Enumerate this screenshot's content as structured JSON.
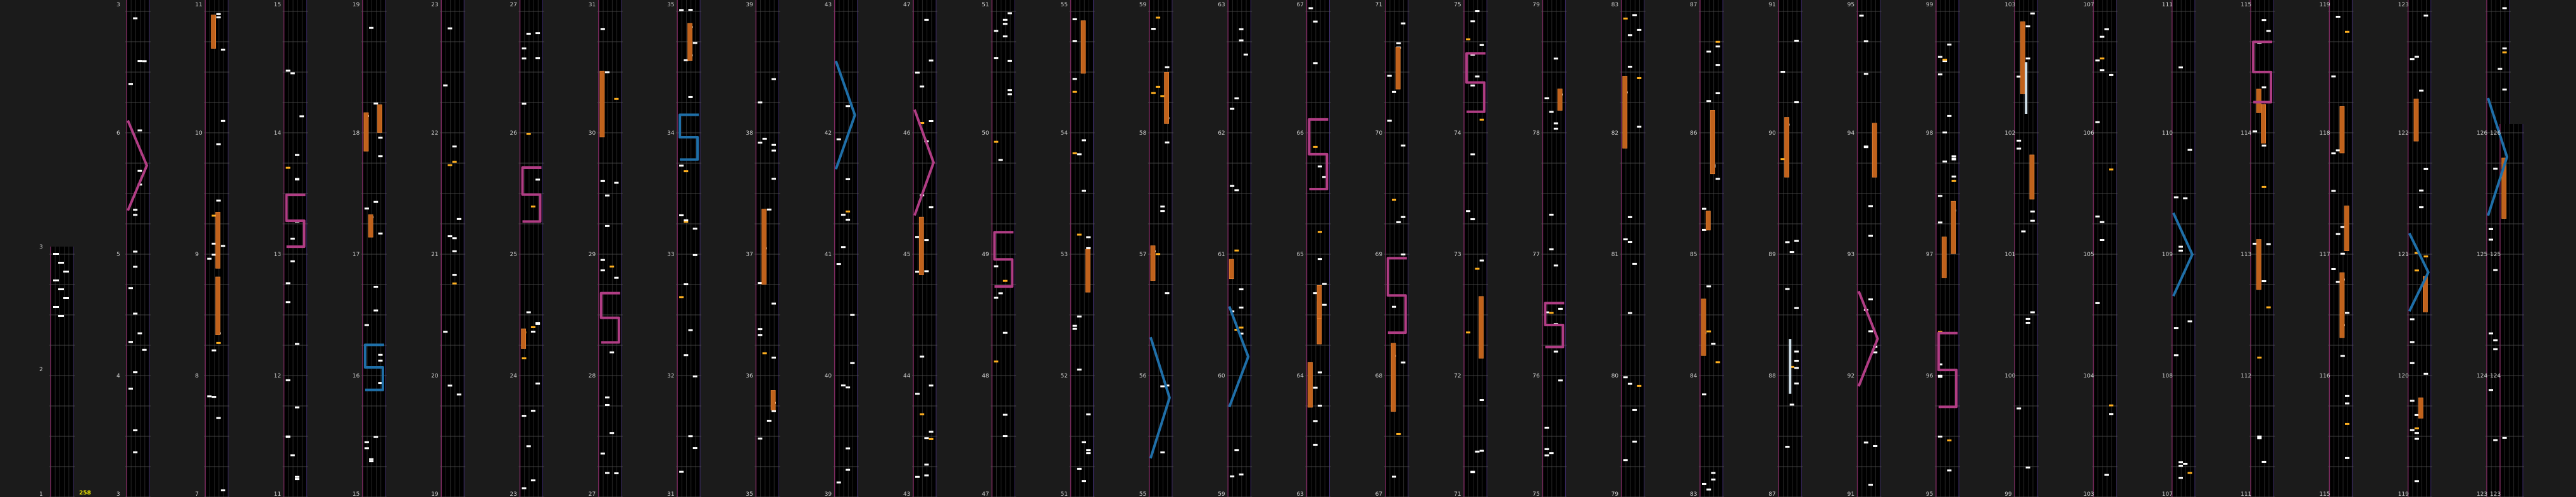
{
  "chart_view": {
    "left_column": {
      "measures": [
        "1",
        "2",
        "3"
      ],
      "combo": "258"
    },
    "measure_labels_first": [
      "3",
      "11",
      "15",
      "19",
      "23",
      "27",
      "31",
      "35",
      "39",
      "43",
      "47",
      "51",
      "55",
      "59",
      "63",
      "67",
      "71",
      "75",
      "79",
      "83",
      "87",
      "91",
      "95",
      "99",
      "103",
      "107",
      "111",
      "115",
      "119",
      "123"
    ],
    "measure_labels_last": [
      "3",
      "7",
      "11",
      "15",
      "19",
      "23",
      "27",
      "31",
      "35",
      "39",
      "43",
      "47",
      "51",
      "55",
      "59",
      "63",
      "67",
      "71",
      "75",
      "79",
      "83",
      "87",
      "91",
      "95",
      "99",
      "103",
      "107",
      "111",
      "115",
      "119",
      "123"
    ],
    "last_column": {
      "measures": [
        "123",
        "124",
        "125",
        "126"
      ]
    },
    "colors": {
      "background": "#1b1b1b",
      "lane": "#000000",
      "beat_line": "#555555",
      "subdivision_line": "#262626",
      "left_border": "#7a2a5e",
      "tap_note": "#ffffff",
      "gold_note": "#ffb020",
      "hold_note": "#c0621c",
      "pink_slide": "#b03d84",
      "blue_slide": "#1f6fa8",
      "white_slide": "#cfe0ea",
      "combo_text": "#e8e000"
    }
  }
}
